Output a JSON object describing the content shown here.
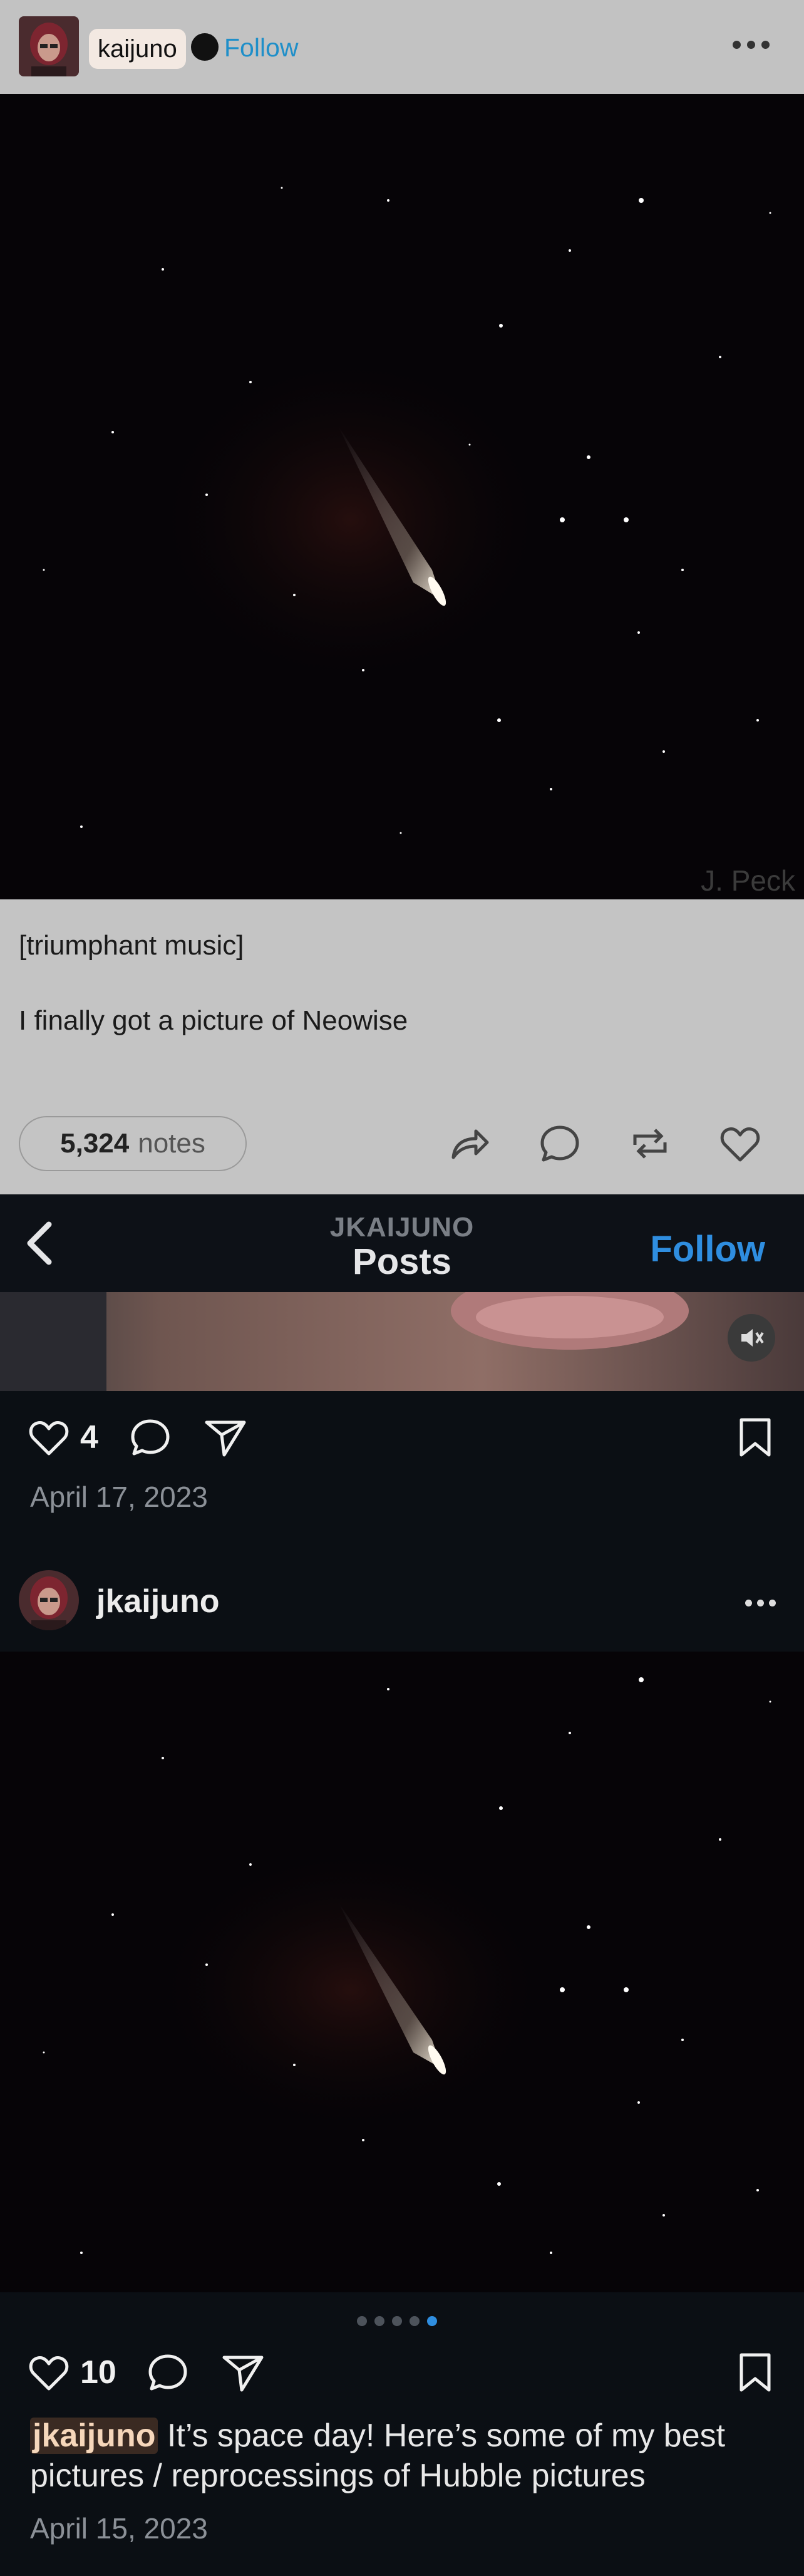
{
  "tumblr": {
    "username": "kaijuno",
    "follow": "Follow",
    "watermark": "J. Peck",
    "caption_line1": "[triumphant music]",
    "caption_line2": "I finally got a picture of Neowise",
    "notes_count": "5,324",
    "notes_label": "notes",
    "actions": [
      "share-icon",
      "reply-icon",
      "reblog-icon",
      "like-icon"
    ]
  },
  "instagram": {
    "nav": {
      "subtitle": "JKAIJUNO",
      "title": "Posts",
      "follow": "Follow"
    },
    "post1": {
      "likes": "4",
      "date": "April 17, 2023"
    },
    "post2": {
      "username": "jkaijuno",
      "carousel_total": 5,
      "carousel_active": 5,
      "likes": "10",
      "caption_user": "jkaijuno",
      "caption_text": " It’s space day! Here’s some of my best pictures / reprocessings of Hubble pictures",
      "date": "April 15, 2023"
    }
  },
  "colors": {
    "follow_blue_tumblr": "#1f8fc9",
    "follow_blue_ig": "#2f8ee0",
    "dark_bg": "#0b0f14"
  }
}
